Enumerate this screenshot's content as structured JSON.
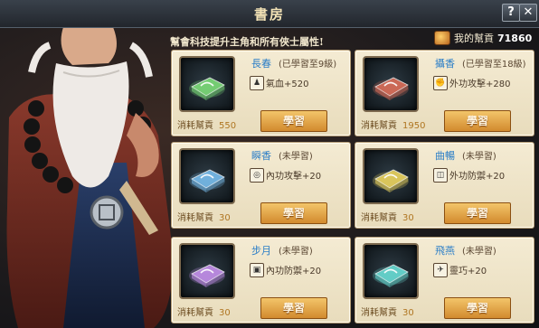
{
  "window": {
    "title": "書房"
  },
  "controls": {
    "help_label": "?",
    "close_label": "✕"
  },
  "header": {
    "notice": "幫會科技提升主角和所有俠士屬性!",
    "currency_label": "我的幫貢",
    "currency_value": "71860"
  },
  "learn_label": "學習",
  "cost_label": "消耗幫貢",
  "skills": [
    {
      "name": "長春",
      "status": "(已學習至9級)",
      "attr_icon": "person-icon",
      "attr_glyph": "♟",
      "attr": "氣血+520",
      "cost": "550",
      "scroll_color": "#7ee07a"
    },
    {
      "name": "攝香",
      "status": "(已學習至18級)",
      "attr_icon": "fist-icon",
      "attr_glyph": "✊",
      "attr": "外功攻擊+280",
      "cost": "1950",
      "scroll_color": "#e0705a"
    },
    {
      "name": "瞬香",
      "status": "(未學習)",
      "attr_icon": "swirl-icon",
      "attr_glyph": "◎",
      "attr": "內功攻擊+20",
      "cost": "30",
      "scroll_color": "#7ac0f0"
    },
    {
      "name": "曲暢",
      "status": "(未學習)",
      "attr_icon": "shield-icon",
      "attr_glyph": "◫",
      "attr": "外功防禦+20",
      "cost": "30",
      "scroll_color": "#f0d860"
    },
    {
      "name": "步月",
      "status": "(未學習)",
      "attr_icon": "box-shield-icon",
      "attr_glyph": "▣",
      "attr": "內功防禦+20",
      "cost": "30",
      "scroll_color": "#c892f0"
    },
    {
      "name": "飛燕",
      "status": "(未學習)",
      "attr_icon": "runner-icon",
      "attr_glyph": "✈",
      "attr": "靈巧+20",
      "cost": "30",
      "scroll_color": "#6ae0d8"
    }
  ]
}
